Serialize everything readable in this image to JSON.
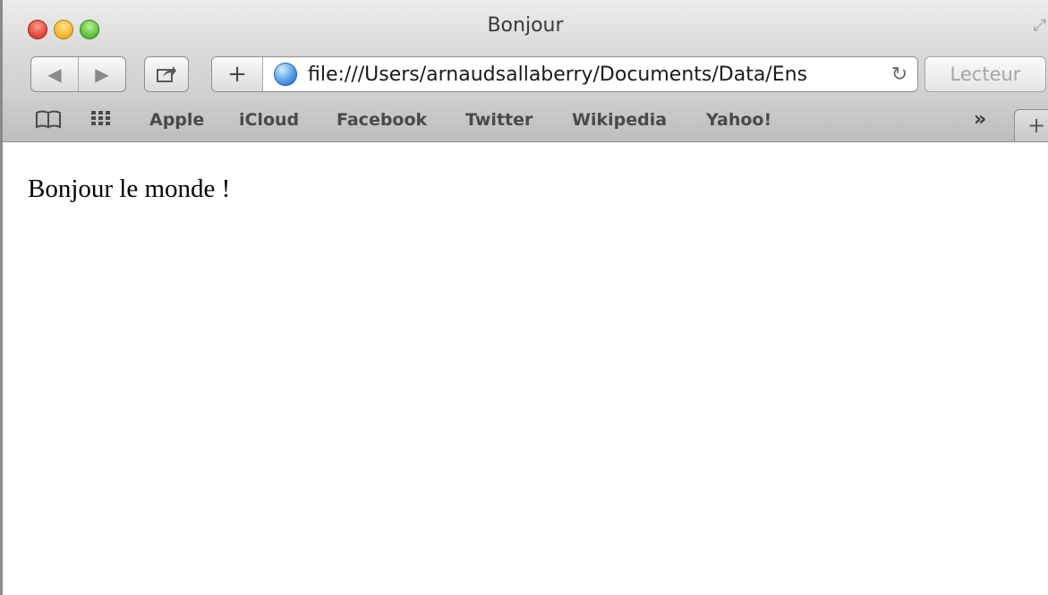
{
  "window": {
    "title": "Bonjour"
  },
  "toolbar": {
    "back_icon": "◀",
    "forward_icon": "▶",
    "share_icon": "share-icon",
    "add_bookmark_label": "+",
    "url": "file:///Users/arnaudsallaberry/Documents/Data/Ens",
    "reload_icon": "↻",
    "reader_label": "Lecteur"
  },
  "bookmarks": {
    "items": [
      {
        "label": "Apple"
      },
      {
        "label": "iCloud"
      },
      {
        "label": "Facebook"
      },
      {
        "label": "Twitter"
      },
      {
        "label": "Wikipedia"
      },
      {
        "label": "Yahoo!"
      }
    ],
    "overflow_label": "»",
    "new_tab_label": "+"
  },
  "page": {
    "text": "Bonjour le monde !"
  },
  "colors": {
    "close": "#e0473a",
    "minimize": "#f5b62c",
    "zoom": "#5ec03c"
  }
}
